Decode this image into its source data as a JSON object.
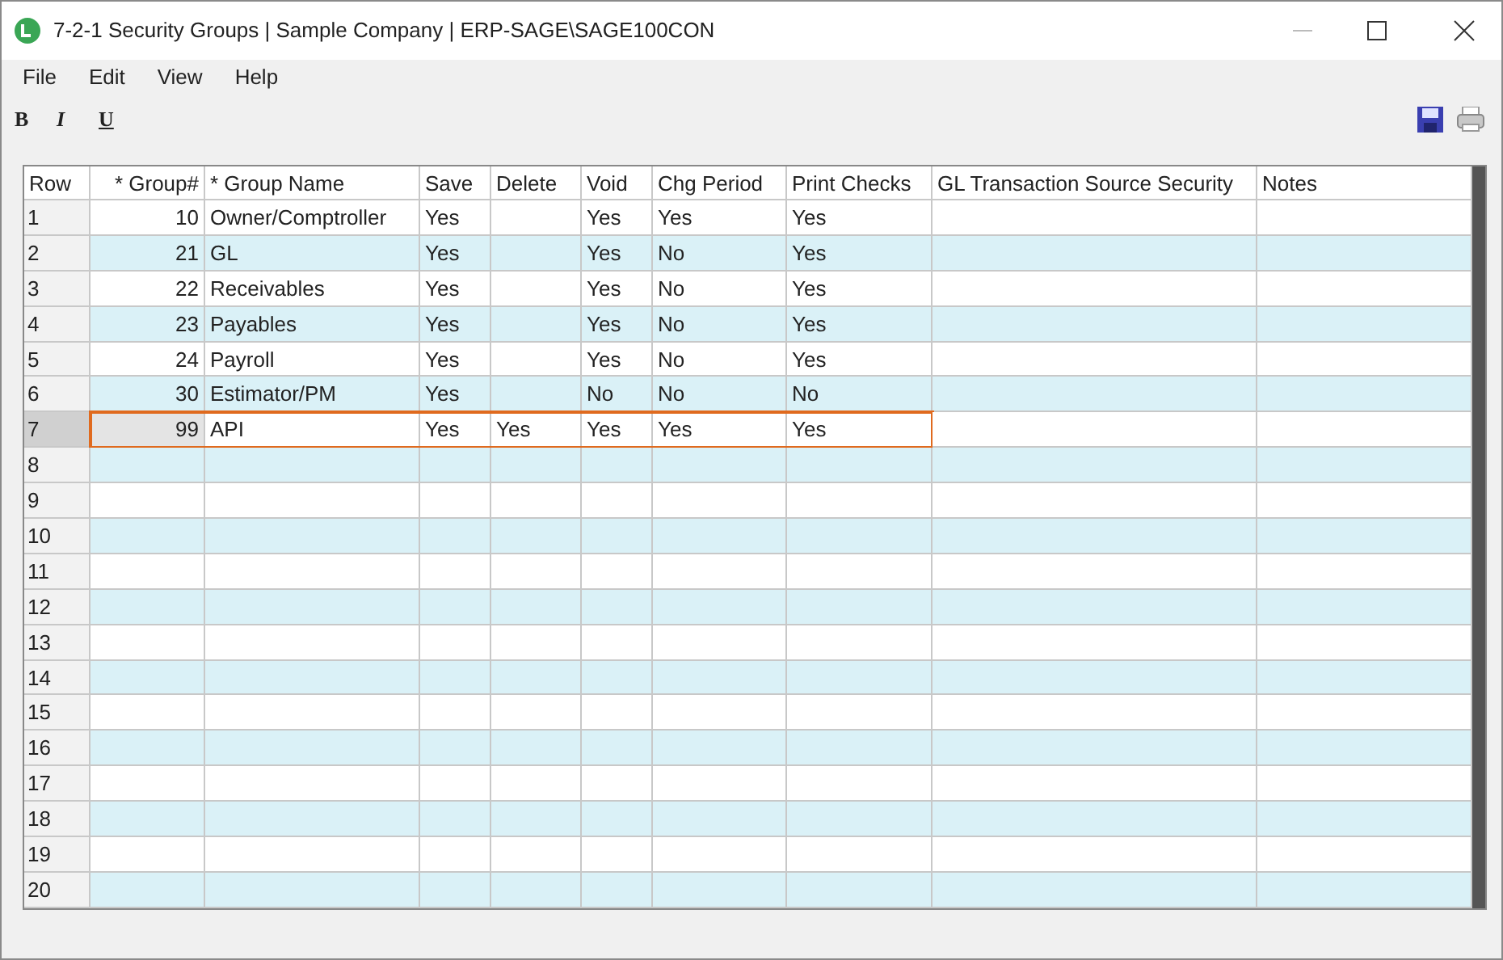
{
  "window": {
    "title": "7-2-1 Security Groups | Sample Company | ERP-SAGE\\SAGE100CON"
  },
  "menu": [
    "File",
    "Edit",
    "View",
    "Help"
  ],
  "format_buttons": [
    "B",
    "I",
    "U"
  ],
  "table": {
    "columns": [
      "Row",
      "* Group#",
      "* Group Name",
      "Save",
      "Delete",
      "Void",
      "Chg Period",
      "Print Checks",
      "GL Transaction Source Security",
      "Notes"
    ],
    "rows": [
      {
        "row": "1",
        "group": "10",
        "name": "Owner/Comptroller",
        "save": "Yes",
        "void": "Yes",
        "chg_period": "Yes",
        "print_checks": "Yes",
        "selected": false
      },
      {
        "row": "2",
        "group": "21",
        "name": "GL",
        "save": "Yes",
        "void": "Yes",
        "chg_period": "No",
        "print_checks": "Yes",
        "selected": false
      },
      {
        "row": "3",
        "group": "22",
        "name": "Receivables",
        "save": "Yes",
        "void": "Yes",
        "chg_period": "No",
        "print_checks": "Yes",
        "selected": false
      },
      {
        "row": "4",
        "group": "23",
        "name": "Payables",
        "save": "Yes",
        "void": "Yes",
        "chg_period": "No",
        "print_checks": "Yes",
        "selected": false
      },
      {
        "row": "5",
        "group": "24",
        "name": "Payroll",
        "save": "Yes",
        "void": "Yes",
        "chg_period": "No",
        "print_checks": "Yes",
        "selected": false
      },
      {
        "row": "6",
        "group": "30",
        "name": "Estimator/PM",
        "save": "Yes",
        "void": "No",
        "chg_period": "No",
        "print_checks": "No",
        "selected": false
      },
      {
        "row": "7",
        "group": "99",
        "name": "API",
        "save": "Yes",
        "delete": "Yes",
        "void": "Yes",
        "chg_period": "Yes",
        "print_checks": "Yes",
        "selected": true
      },
      {
        "row": "8",
        "selected": false
      },
      {
        "row": "9",
        "selected": false
      },
      {
        "row": "10",
        "selected": false
      },
      {
        "row": "11",
        "selected": false
      },
      {
        "row": "12",
        "selected": false
      },
      {
        "row": "13",
        "selected": false
      },
      {
        "row": "14",
        "selected": false
      },
      {
        "row": "15",
        "selected": false
      },
      {
        "row": "16",
        "selected": false
      },
      {
        "row": "17",
        "selected": false
      },
      {
        "row": "18",
        "selected": false
      },
      {
        "row": "19",
        "selected": false
      },
      {
        "row": "20",
        "selected": false
      }
    ]
  }
}
